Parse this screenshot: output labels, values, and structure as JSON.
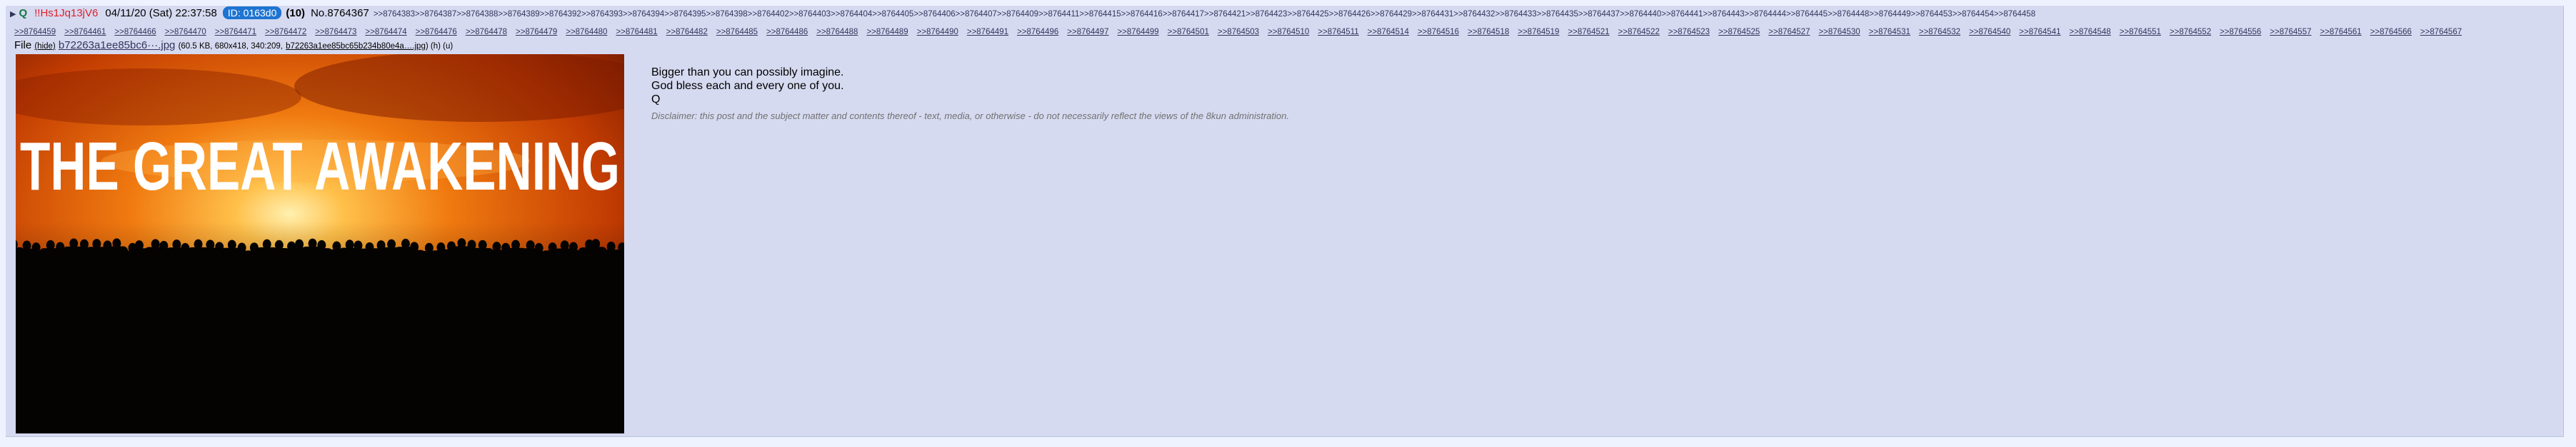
{
  "post": {
    "arrow": "▶",
    "capcode": "Q",
    "tripcode": "!!Hs1Jq13jV6",
    "datetime": "04/11/20 (Sat) 22:37:58",
    "id_badge": "ID: 0163d0",
    "post_count": "(10)",
    "post_number": "No.8764367"
  },
  "backlinks": [
    ">>8764383",
    ">>8764387",
    ">>8764388",
    ">>8764389",
    ">>8764392",
    ">>8764393",
    ">>8764394",
    ">>8764395",
    ">>8764398",
    ">>8764402",
    ">>8764403",
    ">>8764404",
    ">>8764405",
    ">>8764406",
    ">>8764407",
    ">>8764409",
    ">>8764411",
    ">>8764415",
    ">>8764416",
    ">>8764417",
    ">>8764421",
    ">>8764423",
    ">>8764425",
    ">>8764426",
    ">>8764429",
    ">>8764431",
    ">>8764432",
    ">>8764433",
    ">>8764435",
    ">>8764437",
    ">>8764440",
    ">>8764441",
    ">>8764443",
    ">>8764444",
    ">>8764445",
    ">>8764448",
    ">>8764449",
    ">>8764453",
    ">>8764454",
    ">>8764458",
    ">>8764459",
    ">>8764461",
    ">>8764466",
    ">>8764470",
    ">>8764471",
    ">>8764472",
    ">>8764473",
    ">>8764474",
    ">>8764476",
    ">>8764478",
    ">>8764479",
    ">>8764480",
    ">>8764481",
    ">>8764482",
    ">>8764485",
    ">>8764486",
    ">>8764488",
    ">>8764489",
    ">>8764490",
    ">>8764491",
    ">>8764496",
    ">>8764497",
    ">>8764499",
    ">>8764501",
    ">>8764503",
    ">>8764510",
    ">>8764511",
    ">>8764514",
    ">>8764516",
    ">>8764518",
    ">>8764519",
    ">>8764521",
    ">>8764522",
    ">>8764523",
    ">>8764525",
    ">>8764527",
    ">>8764530",
    ">>8764531",
    ">>8764532",
    ">>8764540",
    ">>8764541",
    ">>8764548",
    ">>8764551",
    ">>8764552",
    ">>8764556",
    ">>8764557",
    ">>8764561",
    ">>8764566",
    ">>8764567"
  ],
  "file": {
    "label": "File",
    "hide": "(hide)",
    "filename": "b72263a1ee85bc6···.jpg",
    "meta": "(60.5 KB, 680x418, 340:209,",
    "original_name": "b72263a1ee85bc65b234b80e4a….jpg",
    "tail": ") (h) (u)"
  },
  "image": {
    "caption": "THE GREAT AWAKENING",
    "colors": {
      "sky_top": "#b83200",
      "sky_mid": "#f07a10",
      "glow": "#ffd27a",
      "crowd": "#050302"
    }
  },
  "message": {
    "lines": [
      "Bigger than you can possibly imagine.",
      "God bless each and every one of you.",
      "Q"
    ],
    "disclaimer": "Disclaimer: this post and the subject matter and contents thereof - text, media, or otherwise - do not necessarily reflect the views of the 8kun administration."
  }
}
